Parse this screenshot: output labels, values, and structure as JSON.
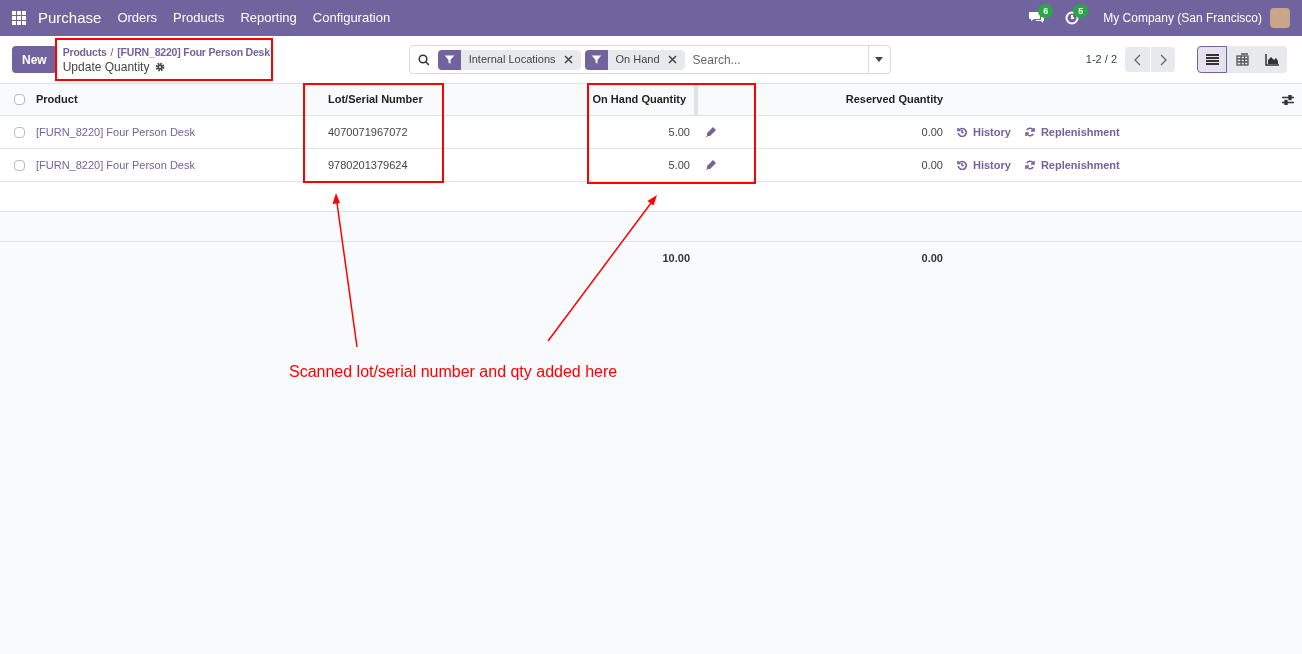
{
  "navbar": {
    "app_name": "Purchase",
    "menu": [
      "Orders",
      "Products",
      "Reporting",
      "Configuration"
    ],
    "messages_badge": "6",
    "activities_badge": "5",
    "company": "My Company (San Francisco)"
  },
  "control_panel": {
    "new_button": "New",
    "breadcrumb": [
      {
        "label": "Products"
      },
      {
        "label": "[FURN_8220] Four Person Desk"
      }
    ],
    "separator": "/",
    "subtitle": "Update Quantity",
    "search": {
      "facets": [
        {
          "label": "Internal Locations"
        },
        {
          "label": "On Hand"
        }
      ],
      "placeholder": "Search..."
    },
    "pager": "1-2 / 2",
    "views": [
      {
        "kind": "list",
        "selected": true
      },
      {
        "kind": "pivot",
        "selected": false
      },
      {
        "kind": "graph",
        "selected": false
      }
    ]
  },
  "table": {
    "select_all_checked": false,
    "columns": [
      "Product",
      "Lot/Serial Number",
      "On Hand Quantity",
      "Reserved Quantity"
    ],
    "rows": [
      {
        "product": "[FURN_8220] Four Person Desk",
        "lot": "4070071967072",
        "on_hand": "5.00",
        "reserved": "0.00",
        "checked": false,
        "actions": [
          "History",
          "Replenishment"
        ]
      },
      {
        "product": "[FURN_8220] Four Person Desk",
        "lot": "9780201379624",
        "on_hand": "5.00",
        "reserved": "0.00",
        "checked": false,
        "actions": [
          "History",
          "Replenishment"
        ]
      }
    ],
    "totals": {
      "on_hand": "10.00",
      "reserved": "0.00"
    }
  },
  "annotation": {
    "text": "Scanned lot/serial number and qty added here"
  }
}
